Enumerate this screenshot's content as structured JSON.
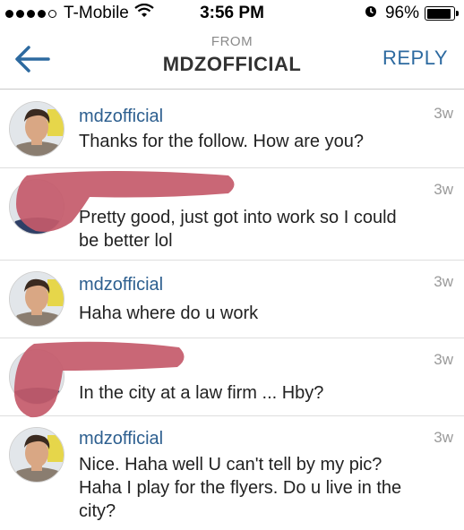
{
  "status_bar": {
    "carrier": "T-Mobile",
    "time": "3:56 PM",
    "battery": "96%",
    "battery_level": 0.96
  },
  "header": {
    "from_label": "FROM",
    "title": "MDZOFFICIAL",
    "reply_label": "REPLY"
  },
  "messages": [
    {
      "username": "mdzofficial",
      "text": "Thanks for the follow. How are you?",
      "time": "3w"
    },
    {
      "username": "",
      "text": "Pretty good, just got into work so I could be better lol",
      "time": "3w"
    },
    {
      "username": "mdzofficial",
      "text": "Haha where do u work",
      "time": "3w"
    },
    {
      "username": "",
      "text": "In the city at a law firm ... Hby?",
      "time": "3w"
    },
    {
      "username": "mdzofficial",
      "text": "Nice. Haha well U can't tell by my pic? Haha I play for the flyers. Do u live in the city?",
      "time": "3w"
    }
  ],
  "colors": {
    "link_blue": "#2d6aa0",
    "username_blue": "#2d5f8f",
    "scribble_red": "#c45a6a"
  }
}
